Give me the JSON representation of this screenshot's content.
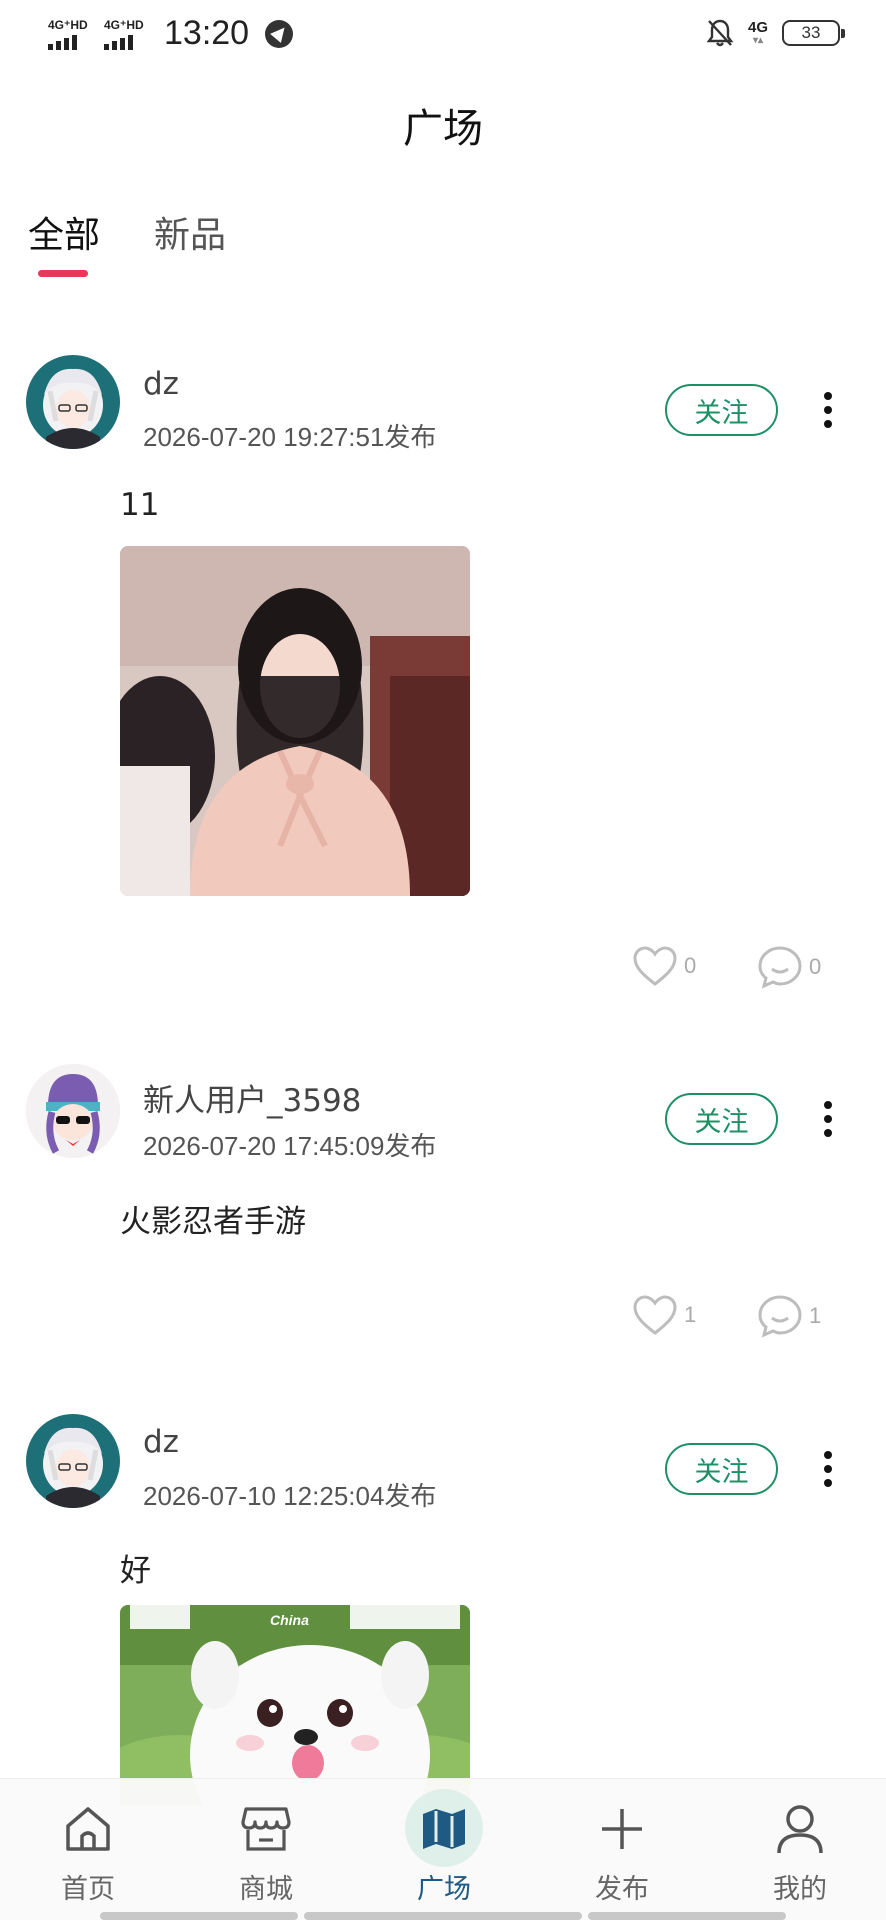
{
  "status_bar": {
    "sim1": "4G⁺HD",
    "sim2": "4G⁺HD",
    "time": "13:20",
    "network": "4G",
    "battery": "33"
  },
  "header": {
    "title": "广场"
  },
  "tabs": [
    {
      "label": "全部",
      "active": true
    },
    {
      "label": "新品",
      "active": false
    }
  ],
  "posts": [
    {
      "username": "dz",
      "timestamp": "2026-07-20 19:27:51发布",
      "follow_label": "关注",
      "text": "11",
      "has_image": true,
      "likes": "0",
      "comments": "0"
    },
    {
      "username": "新人用户_3598",
      "timestamp": "2026-07-20 17:45:09发布",
      "follow_label": "关注",
      "text": "火影忍者手游",
      "has_image": false,
      "likes": "1",
      "comments": "1"
    },
    {
      "username": "dz",
      "timestamp": "2026-07-10 12:25:04发布",
      "follow_label": "关注",
      "text": "好",
      "has_image": true,
      "image_overlay_text": "China"
    }
  ],
  "bottom_nav": [
    {
      "label": "首页",
      "icon": "home-icon"
    },
    {
      "label": "商城",
      "icon": "store-icon"
    },
    {
      "label": "广场",
      "icon": "map-icon",
      "active": true
    },
    {
      "label": "发布",
      "icon": "plus-icon"
    },
    {
      "label": "我的",
      "icon": "user-icon"
    }
  ],
  "colors": {
    "accent_underline": "#e8375a",
    "follow_green": "#1e9066",
    "nav_active": "#1f5a85"
  }
}
